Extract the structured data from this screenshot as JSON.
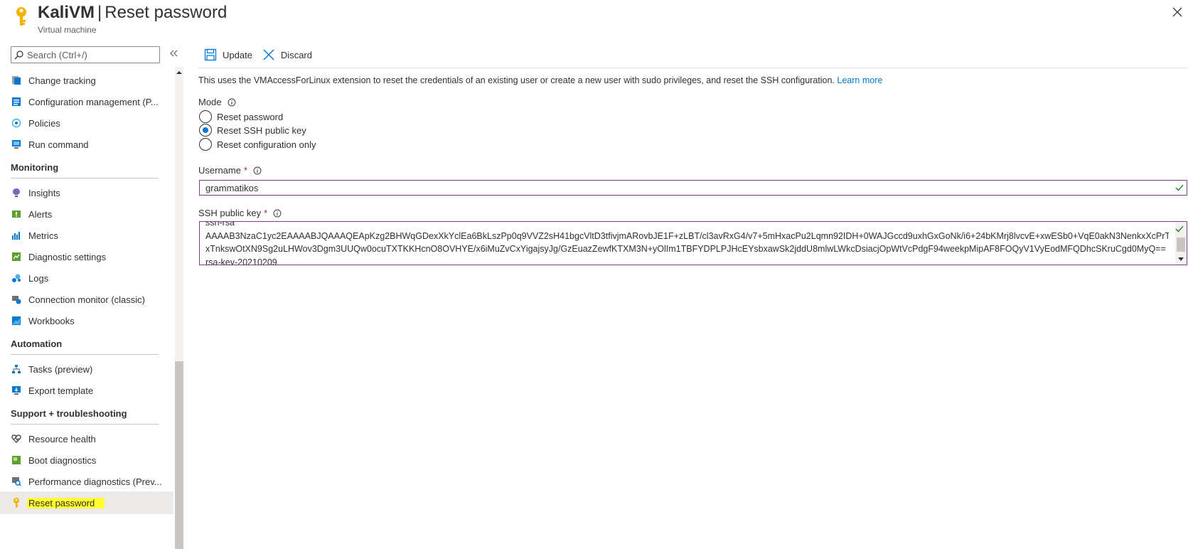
{
  "header": {
    "resource_name": "KaliVM",
    "separator": "|",
    "page_name": "Reset password",
    "subtitle": "Virtual machine"
  },
  "sidebar": {
    "search_placeholder": "Search (Ctrl+/)",
    "items_top": [
      {
        "label": "Change tracking",
        "icon": "change-tracking-icon"
      },
      {
        "label": "Configuration management (P...",
        "icon": "configuration-icon"
      },
      {
        "label": "Policies",
        "icon": "policies-icon"
      },
      {
        "label": "Run command",
        "icon": "run-command-icon"
      }
    ],
    "monitoring": {
      "header": "Monitoring",
      "items": [
        {
          "label": "Insights",
          "icon": "insights-icon"
        },
        {
          "label": "Alerts",
          "icon": "alerts-icon"
        },
        {
          "label": "Metrics",
          "icon": "metrics-icon"
        },
        {
          "label": "Diagnostic settings",
          "icon": "diagnostic-settings-icon"
        },
        {
          "label": "Logs",
          "icon": "logs-icon"
        },
        {
          "label": "Connection monitor (classic)",
          "icon": "connection-monitor-icon"
        },
        {
          "label": "Workbooks",
          "icon": "workbooks-icon"
        }
      ]
    },
    "automation": {
      "header": "Automation",
      "items": [
        {
          "label": "Tasks (preview)",
          "icon": "tasks-icon"
        },
        {
          "label": "Export template",
          "icon": "export-template-icon"
        }
      ]
    },
    "support": {
      "header": "Support + troubleshooting",
      "items": [
        {
          "label": "Resource health",
          "icon": "resource-health-icon"
        },
        {
          "label": "Boot diagnostics",
          "icon": "boot-diagnostics-icon"
        },
        {
          "label": "Performance diagnostics (Prev...",
          "icon": "performance-diagnostics-icon"
        },
        {
          "label": "Reset password",
          "icon": "key-icon"
        }
      ]
    }
  },
  "toolbar": {
    "update_label": "Update",
    "discard_label": "Discard"
  },
  "description": {
    "text": "This uses the VMAccessForLinux extension to reset the credentials of an existing user or create a new user with sudo privileges, and reset the SSH configuration.",
    "link": "Learn more"
  },
  "mode": {
    "label": "Mode",
    "options": [
      {
        "label": "Reset password",
        "selected": false
      },
      {
        "label": "Reset SSH public key",
        "selected": true
      },
      {
        "label": "Reset configuration only",
        "selected": false
      }
    ]
  },
  "username": {
    "label": "Username",
    "required_mark": "*",
    "value": "grammatikos"
  },
  "ssh_key": {
    "label": "SSH public key",
    "required_mark": "*",
    "lines": [
      "ssh-rsa",
      "AAAAB3NzaC1yc2EAAAABJQAAAQEApKzg2BHWqGDexXkYclEa6BkLszPp0q9VVZ2sH41bgcVltD3tfivjmARovbJE1F+zLBT/cl3avRxG4/v7+5mHxacPu2Lqmn92IDH+0WAJGccd9uxhGxGoNk/i6+24bKMrj8lvcvE+xwESb0+VqE0akN3NenkxXcPrT",
      "xTnkswOtXN9Sg2uLHWov3Dgm3UUQw0ocuTXTKKHcnO8OVHYE/x6iMuZvCxYigajsyJg/GzEuazZewfKTXM3N+yOlIm1TBFYDPLPJHcEYsbxawSk2jddU8mlwLWkcDsiacjOpWtVcPdgF94weekpMipAF8FOQyV1VyEodMFQDhcSKruCgd0MyQ==",
      "rsa-key-20210209"
    ]
  },
  "colors": {
    "accent": "#0078d4",
    "input_border": "#8a3a96",
    "highlight": "#ffff33",
    "valid": "#107c10"
  }
}
